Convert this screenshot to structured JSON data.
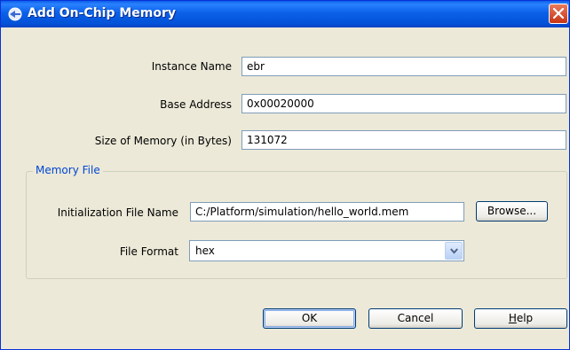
{
  "window": {
    "title": "Add On-Chip Memory"
  },
  "form": {
    "instance_name": {
      "label": "Instance Name",
      "value": "ebr"
    },
    "base_address": {
      "label": "Base Address",
      "value": "0x00020000"
    },
    "size_of_memory": {
      "label": "Size of Memory (in Bytes)",
      "value": "131072"
    }
  },
  "memory_file": {
    "legend": "Memory File",
    "init_file": {
      "label": "Initialization File Name",
      "value": "C:/Platform/simulation/hello_world.mem"
    },
    "browse_label": "Browse...",
    "file_format": {
      "label": "File Format",
      "value": "hex"
    }
  },
  "buttons": {
    "ok": "OK",
    "cancel": "Cancel",
    "help_first": "H",
    "help_rest": "elp"
  },
  "colors": {
    "title_bar": "#0a5ee8",
    "legend_text": "#0046d5",
    "close_button": "#c73414"
  }
}
